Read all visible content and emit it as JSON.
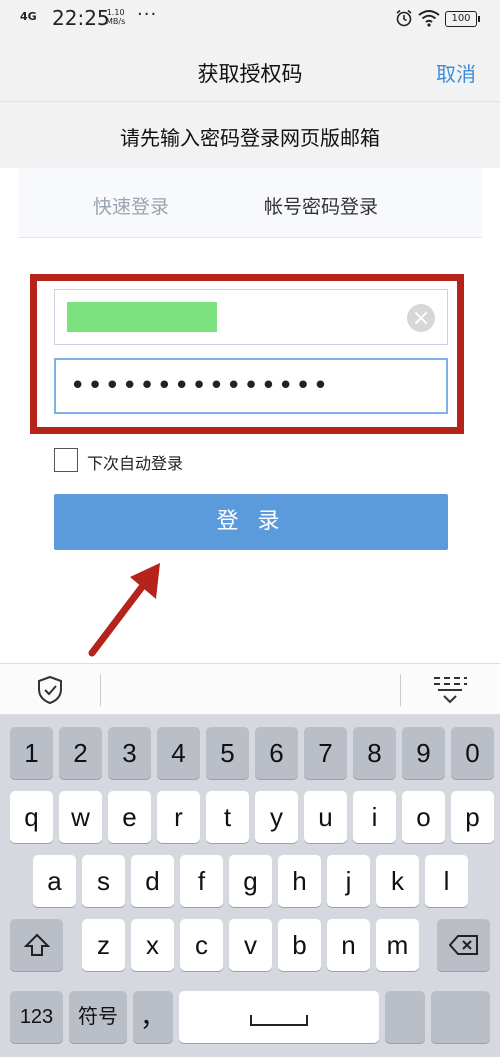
{
  "status_bar": {
    "network": "4G",
    "time": "22:25",
    "speed_top": "1.10",
    "speed_bottom": "MB/s",
    "dots": "···",
    "battery": "100"
  },
  "navbar": {
    "title": "获取授权码",
    "cancel": "取消"
  },
  "subtitle": "请先输入密码登录网页版邮箱",
  "tabs": {
    "quick": "快速登录",
    "account": "帐号密码登录"
  },
  "form": {
    "password_value": "•••••••••••••••",
    "remember_label": "下次自动登录",
    "login_button": "登 录"
  },
  "keyboard": {
    "row1": [
      "1",
      "2",
      "3",
      "4",
      "5",
      "6",
      "7",
      "8",
      "9",
      "0"
    ],
    "row2": [
      "q",
      "w",
      "e",
      "r",
      "t",
      "y",
      "u",
      "i",
      "o",
      "p"
    ],
    "row3": [
      "a",
      "s",
      "d",
      "f",
      "g",
      "h",
      "j",
      "k",
      "l"
    ],
    "row4": [
      "z",
      "x",
      "c",
      "v",
      "b",
      "n",
      "m"
    ],
    "num_key": "123",
    "symbol_key": "符号",
    "comma_key": "，"
  },
  "colors": {
    "accent": "#3d8ed8",
    "button": "#5b9bdc",
    "highlight_box": "#b5231b",
    "mask": "#7ce27f"
  },
  "icons": [
    "alarm-icon",
    "wifi-icon",
    "clear-icon",
    "shield-icon",
    "keyboard-hide-icon",
    "shift-icon",
    "backspace-icon",
    "space-icon"
  ]
}
